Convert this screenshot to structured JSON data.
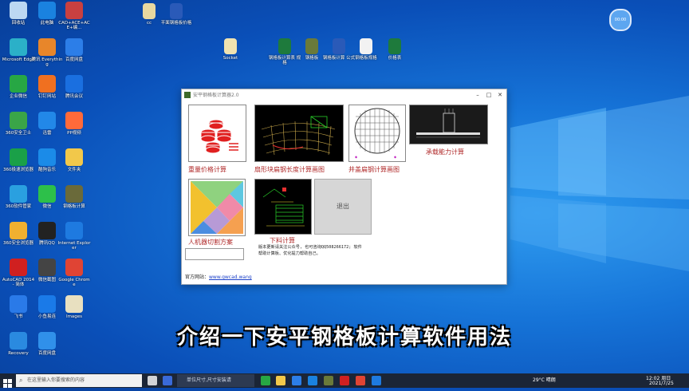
{
  "desktop": {
    "left_icons": [
      {
        "label": "回收站",
        "color": "#bcd8f2"
      },
      {
        "label": "此电脑",
        "color": "#1a82e0"
      },
      {
        "label": "CAD+ACE+ACE+编...",
        "color": "#c84040"
      },
      {
        "label": "Microsoft Edge",
        "color": "#2bb0c8"
      },
      {
        "label": "腾讯 Everything",
        "color": "#e8862a"
      },
      {
        "label": "百度网盘",
        "color": "#2c7ee8"
      },
      {
        "label": "企业微信",
        "color": "#27a744"
      },
      {
        "label": "钉钉网站",
        "color": "#f07020"
      },
      {
        "label": "腾讯会议",
        "color": "#1a6fe0"
      },
      {
        "label": "360安全卫士",
        "color": "#3aa548"
      },
      {
        "label": "迅雷",
        "color": "#2288e8"
      },
      {
        "label": "PP视频",
        "color": "#ff6a3a"
      },
      {
        "label": "360极速浏览器",
        "color": "#1aa048"
      },
      {
        "label": "酷狗音乐",
        "color": "#1b8be8"
      },
      {
        "label": "文件夹",
        "color": "#f2c84a"
      },
      {
        "label": "360软件管家",
        "color": "#2aa0e0"
      },
      {
        "label": "微信",
        "color": "#2dc04a"
      },
      {
        "label": "钢格板计算",
        "color": "#6a6a3a"
      },
      {
        "label": "360安全浏览器",
        "color": "#f0b030"
      },
      {
        "label": "腾讯QQ",
        "color": "#222222"
      },
      {
        "label": "Internet Explorer",
        "color": "#1e7ae0"
      },
      {
        "label": "AutoCAD 2014 - 简体",
        "color": "#d02020"
      },
      {
        "label": "微信截图",
        "color": "#444444"
      },
      {
        "label": "Google Chrome",
        "color": "#e04434"
      },
      {
        "label": "飞书",
        "color": "#2a7ae8"
      },
      {
        "label": "小鱼易连",
        "color": "#1a7ae8"
      },
      {
        "label": "Images",
        "color": "#e8e0c0"
      },
      {
        "label": "Recovery",
        "color": "#2a8ae0"
      },
      {
        "label": "百度网盘",
        "color": "#3090ea"
      }
    ],
    "top_icons": [
      {
        "label": "cc",
        "color": "#e8d8a0"
      },
      {
        "label": "平面钢格板价格",
        "color": "#2a5ab8"
      },
      {
        "label": "Socket",
        "color": "#efe2b0"
      },
      {
        "label": "钢格板计算表 规格",
        "color": "#1e7a3c"
      },
      {
        "label": "钢格板",
        "color": "#6a7a3a"
      },
      {
        "label": "钢格板计算 公式",
        "color": "#2a5ab8"
      },
      {
        "label": "钢格板规格",
        "color": "#f2f2f2"
      },
      {
        "label": "价格表",
        "color": "#1e7a3c"
      }
    ]
  },
  "window": {
    "title": "安平钢格板计算器2.0",
    "tiles": [
      {
        "caption": "重量价格计算"
      },
      {
        "caption": "扇形块扁钢长度计算画图"
      },
      {
        "caption": "井盖扁钢计算画图"
      },
      {
        "caption": "承载能力计算"
      },
      {
        "caption": "人机器切割方案"
      },
      {
        "caption": "下料计算"
      },
      {
        "caption": "退出"
      }
    ],
    "note_line1": "版本更新请关注公众号, 也可咨询QQ508266172; 软件",
    "note_line2": "帮助计算板、优化提力帮助自己。",
    "link_label": "官方网站：",
    "link_url": "www.gwcad.wang"
  },
  "subtitle": "介绍一下安平钢格板计算软件用法",
  "record_label": "00:00",
  "taskbar": {
    "search_placeholder": "在这里输入你要搜索的内容",
    "app_search_text": "单位尺寸,尺寸安装请",
    "weather": "29°C 晴朗",
    "time": "12:02 周日",
    "date": "2021/7/25"
  }
}
